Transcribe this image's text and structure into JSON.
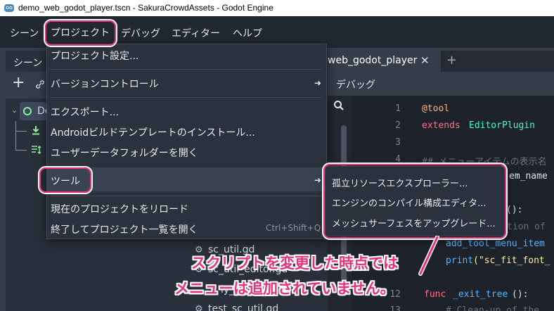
{
  "window": {
    "title": "demo_web_godot_player.tscn - SakuraCrowdAssets - Godot Engine"
  },
  "menubar": {
    "items": [
      "シーン",
      "プロジェクト",
      "デバッグ",
      "エディター",
      "ヘルプ"
    ]
  },
  "scene_dock": {
    "tab_label": "シーン",
    "add_glyph": "+",
    "root_node_label": "De"
  },
  "project_menu": {
    "items": [
      "プロジェクト設定...",
      "バージョンコントロール",
      "エクスポート...",
      "Androidビルドテンプレートのインストール...",
      "ユーザーデータフォルダーを開く",
      "ツール",
      "現在のプロジェクトをリロード",
      "終了してプロジェクト一覧を開く"
    ],
    "quit_shortcut": "Ctrl+Shift+Q"
  },
  "tools_submenu": {
    "items": [
      "孤立リソースエクスプローラー...",
      "エンジンのコンパイル構成エディタ...",
      "メッシュサーフェスをアップグレード..."
    ]
  },
  "script_editor": {
    "tab_label": "web_godot_player",
    "close_glyph": "✕",
    "add_tab_glyph": "+",
    "debug_label": "デバッグ",
    "line_numbers": [
      "1",
      "2",
      "3",
      "4",
      "12",
      "13"
    ],
    "code": {
      "line1": "@tool",
      "line2_kw": "extends",
      "line2_cls": "EditorPlugin",
      "line4": "## メニューアイテムの表示名",
      "frag_a": "em_name",
      "frag_b": "():",
      "frag_c": "tion of",
      "frag_d": "add_tool_menu_item",
      "frag_e_fn": "print",
      "frag_e_str": "(\"sc_fit_font_",
      "line12_kw": "func",
      "line12_name": "_exit_tree",
      "line12_rest": "():",
      "line13": "# Clean-up of the"
    }
  },
  "filesystem": {
    "files": [
      "sc_util.gd",
      "sc_util_editor.gd",
      "test_sc_util.gd"
    ],
    "partial_file": "ly_ui_"
  },
  "annotation": {
    "line1": "スクリプトを変更した時点では",
    "line2": "メニューは追加されていません。",
    "color": "#e8317c"
  },
  "colors": {
    "menubar_bg": "#222831",
    "panel_bg": "#363d4a",
    "menu_bg": "#2c323d",
    "keyword": "#ff7085",
    "class": "#42ffc2",
    "comment": "#676f7d",
    "string": "#ffeda1",
    "function": "#57b3ff"
  }
}
